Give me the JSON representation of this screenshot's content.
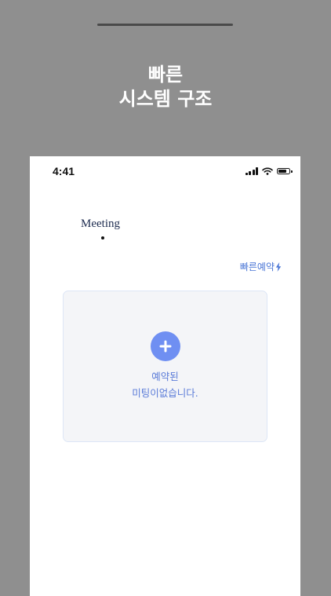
{
  "promo": {
    "headline_line1": "빠른",
    "headline_line2": "시스템 구조"
  },
  "status_bar": {
    "time": "4:41",
    "icons": [
      "cellular-signal-icon",
      "wifi-icon",
      "battery-icon"
    ]
  },
  "app": {
    "brand": "Meeting",
    "quick_booking_label": "빠른예약",
    "quick_booking_icon": "lightning-icon",
    "empty_state": {
      "line1": "예약된",
      "line2": "미팅이없습니다.",
      "add_icon": "plus-icon"
    }
  },
  "colors": {
    "background": "#8f8f8f",
    "accent": "#6f8ff2",
    "link": "#4a76d6",
    "card": "#f4f5f8"
  }
}
